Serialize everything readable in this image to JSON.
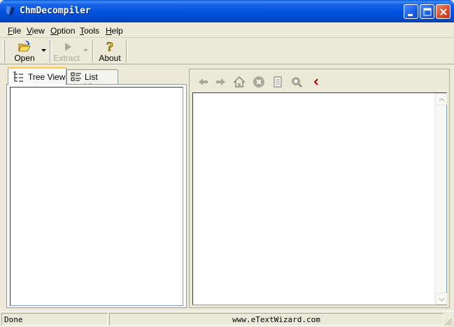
{
  "window": {
    "title": "ChmDecompiler",
    "controls": [
      "minimize",
      "maximize",
      "close"
    ]
  },
  "menu": {
    "items": [
      {
        "label": "File",
        "accel": "F",
        "rest": "ile"
      },
      {
        "label": "View",
        "accel": "V",
        "rest": "iew"
      },
      {
        "label": "Option",
        "accel": "O",
        "rest": "ption"
      },
      {
        "label": "Tools",
        "accel": "T",
        "rest": "ools"
      },
      {
        "label": "Help",
        "accel": "H",
        "rest": "elp"
      }
    ]
  },
  "toolbar": {
    "open_label": "Open",
    "extract_label": "Extract",
    "about_label": "About",
    "open_icon": "open-folder-icon",
    "extract_icon": "play-arrow-icon",
    "about_icon": "help-question-icon"
  },
  "left_tabs": {
    "tree_view": "Tree View",
    "list_view": "List View",
    "active": "Tree View"
  },
  "nav": {
    "icons": [
      "back-arrow-icon",
      "forward-arrow-icon",
      "home-icon",
      "stop-icon",
      "document-icon",
      "search-icon",
      "collapse-icon"
    ]
  },
  "status": {
    "left": "Done",
    "center": "www.eTextWizard.com"
  },
  "colors": {
    "titlebar": "#0052de",
    "face": "#ece9d8",
    "tab_highlight": "#ffc83c",
    "accent_red": "#c00000"
  }
}
